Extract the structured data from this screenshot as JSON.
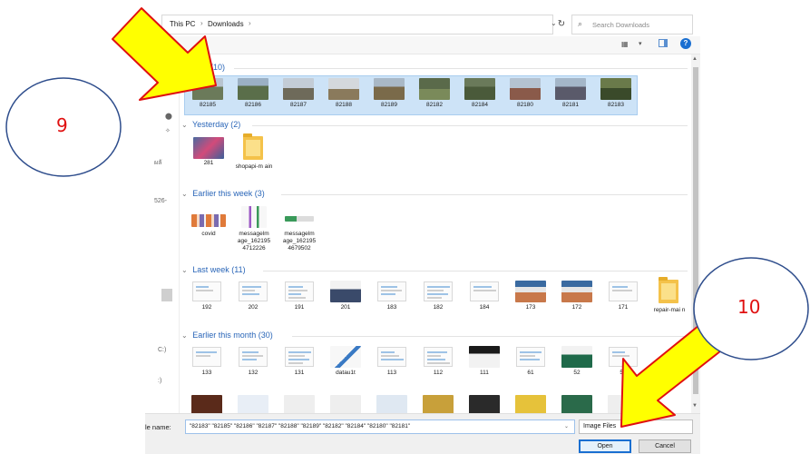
{
  "address": {
    "crumbs": [
      "This PC",
      "Downloads"
    ],
    "separator": "›",
    "dropdown_glyph": "⌄",
    "refresh_glyph": "↻",
    "search_placeholder": "Search Downloads",
    "search_glyph": "⌕"
  },
  "toolbar": {
    "view_glyph": "▦",
    "view_dropdown_glyph": "▾",
    "help_glyph": "?"
  },
  "nav": {
    "glyphs": [
      {
        "text": "⬤",
        "row": 0
      },
      {
        "text": "✧",
        "row": 1
      },
      {
        "text": "ผลั",
        "row": 2
      },
      {
        "text": "526-",
        "row": 3
      },
      {
        "text": "C:)",
        "row": 4
      },
      {
        "text": ":)",
        "row": 5
      }
    ]
  },
  "groups": [
    {
      "title": "(10)",
      "chevron": "⌄"
    },
    {
      "title": "Yesterday (2)",
      "chevron": "⌄"
    },
    {
      "title": "Earlier this week (3)",
      "chevron": "⌄"
    },
    {
      "title": "Last week (11)",
      "chevron": "⌄"
    },
    {
      "title": "Earlier this month (30)",
      "chevron": "⌄"
    }
  ],
  "today_files": [
    "82185",
    "82186",
    "82187",
    "82188",
    "82189",
    "82182",
    "82184",
    "82180",
    "82181",
    "82183"
  ],
  "yesterday_files": [
    "281",
    "shopapi-m ain"
  ],
  "week_files": [
    "covid",
    "messagelm age_162195 4712226",
    "messagelm age_162195 4679502"
  ],
  "lastweek_files": [
    "192",
    "202",
    "191",
    "201",
    "183",
    "182",
    "184",
    "173",
    "172",
    "171",
    "repair-mai n"
  ],
  "month_files": [
    "133",
    "132",
    "131",
    "datau1t",
    "113",
    "112",
    "111",
    "61",
    "52",
    "51"
  ],
  "footer": {
    "filename_label": "le name:",
    "filename_value": "\"82183\" \"82185\" \"82186\" \"82187\" \"82188\" \"82189\" \"82182\" \"82184\" \"82180\" \"82181\"",
    "dropdown_glyph": "⌄",
    "filetype": "Image Files",
    "open_label": "Open",
    "cancel_label": "Cancel"
  },
  "annotations": [
    {
      "label": "9",
      "color": "#e01010"
    },
    {
      "label": "10",
      "color": "#e01010"
    }
  ],
  "colors": {
    "selection": "#cde3f7",
    "accent": "#1a6fd1",
    "arrow_fill": "#ffff00",
    "arrow_stroke": "#e01010",
    "circle_stroke": "#2e4d8c"
  }
}
